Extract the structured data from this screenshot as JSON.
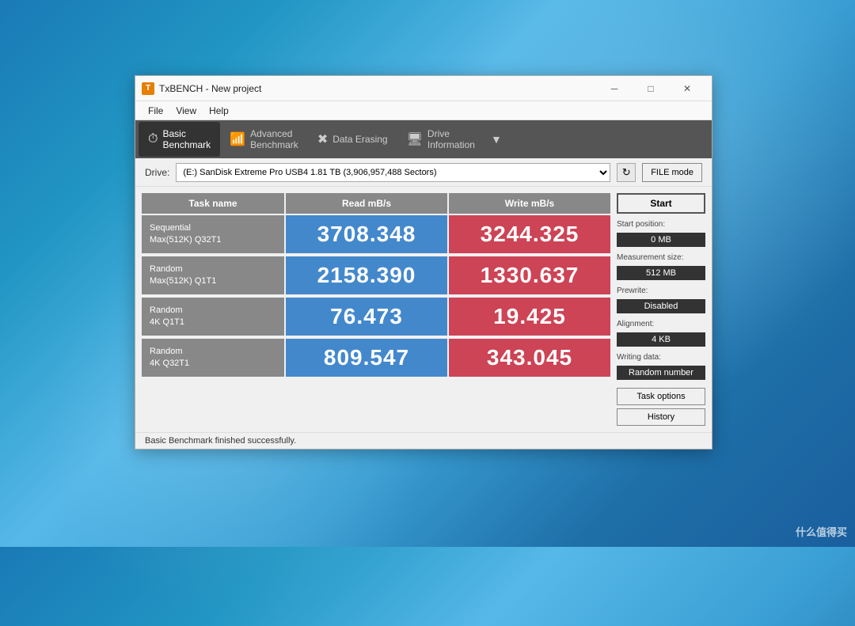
{
  "window": {
    "title": "TxBENCH - New project",
    "icon": "T"
  },
  "titlebar": {
    "minimize": "─",
    "maximize": "□",
    "close": "✕"
  },
  "menu": {
    "items": [
      "File",
      "View",
      "Help"
    ]
  },
  "toolbar": {
    "tabs": [
      {
        "id": "basic",
        "icon": "⏱",
        "label": "Basic\nBenchmark",
        "active": true
      },
      {
        "id": "advanced",
        "icon": "📊",
        "label": "Advanced\nBenchmark",
        "active": false
      },
      {
        "id": "erase",
        "icon": "✖",
        "label": "Data Erasing",
        "active": false
      },
      {
        "id": "drive",
        "icon": "💾",
        "label": "Drive\nInformation",
        "active": false
      }
    ],
    "more": "▼"
  },
  "drive": {
    "label": "Drive:",
    "value": "(E:) SanDisk Extreme Pro USB4  1.81 TB (3,906,957,488 Sectors)",
    "refresh_icon": "↻",
    "file_mode": "FILE mode"
  },
  "table": {
    "headers": [
      "Task name",
      "Read mB/s",
      "Write mB/s"
    ],
    "rows": [
      {
        "label": "Sequential\nMax(512K) Q32T1",
        "read": "3708.348",
        "write": "3244.325"
      },
      {
        "label": "Random\nMax(512K) Q1T1",
        "read": "2158.390",
        "write": "1330.637"
      },
      {
        "label": "Random\n4K Q1T1",
        "read": "76.473",
        "write": "19.425"
      },
      {
        "label": "Random\n4K Q32T1",
        "read": "809.547",
        "write": "343.045"
      }
    ]
  },
  "right_panel": {
    "start_label": "Start",
    "start_position_label": "Start position:",
    "start_position_value": "0 MB",
    "measurement_size_label": "Measurement size:",
    "measurement_size_value": "512 MB",
    "prewrite_label": "Prewrite:",
    "prewrite_value": "Disabled",
    "alignment_label": "Alignment:",
    "alignment_value": "4 KB",
    "writing_data_label": "Writing data:",
    "writing_data_value": "Random number",
    "task_options": "Task options",
    "history": "History"
  },
  "status": {
    "text": "Basic Benchmark finished successfully."
  },
  "watermark": "什么值得买"
}
